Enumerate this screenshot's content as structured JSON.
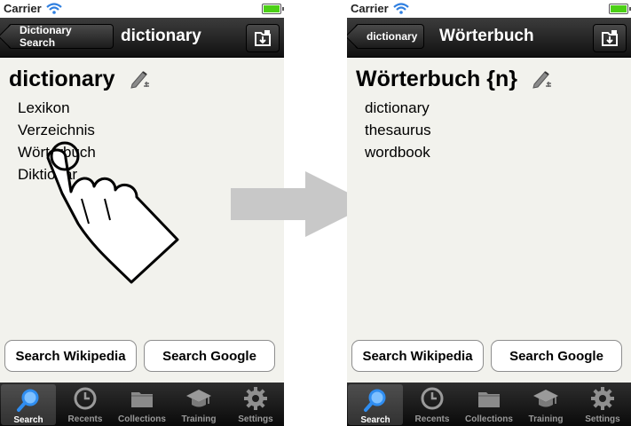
{
  "status": {
    "carrier": "Carrier"
  },
  "left": {
    "back_label": "Dictionary Search",
    "nav_title": "dictionary",
    "entry": "dictionary",
    "translations": [
      "Lexikon",
      "Verzeichnis",
      "Wörterbuch",
      "Diktionär"
    ],
    "search_wikipedia": "Search Wikipedia",
    "search_google": "Search Google",
    "tabs": [
      "Search",
      "Recents",
      "Collections",
      "Training",
      "Settings"
    ],
    "selected_tab": "Search"
  },
  "right": {
    "back_label": "dictionary",
    "nav_title": "Wörterbuch",
    "entry": "Wörterbuch {n}",
    "translations": [
      "dictionary",
      "thesaurus",
      "wordbook"
    ],
    "search_wikipedia": "Search Wikipedia",
    "search_google": "Search Google",
    "tabs": [
      "Search",
      "Recents",
      "Collections",
      "Training",
      "Settings"
    ],
    "selected_tab": "Search"
  },
  "icons": {
    "tab_icons": [
      "magnifier-icon",
      "clock-icon",
      "folder-icon",
      "graduation-cap-icon",
      "gear-icon"
    ],
    "gesture": "tapping-hand-icon",
    "transition": "right-arrow-icon"
  },
  "colors": {
    "background": "#f2f2ed",
    "bar": "#1b1b1b",
    "selected_tab_icon": "#2f8df0",
    "transition_arrow": "#c8c8c8"
  }
}
